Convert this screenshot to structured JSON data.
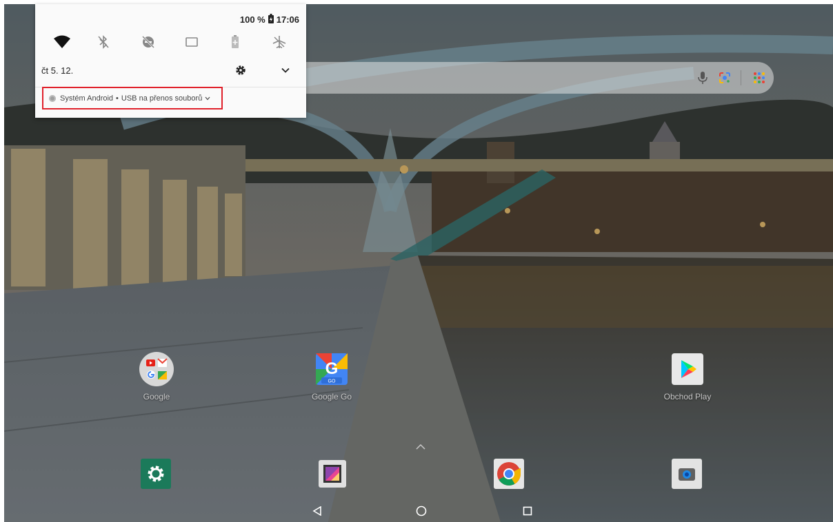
{
  "statusbar": {
    "battery": "100 %",
    "time": "17:06"
  },
  "quick_settings": [
    {
      "name": "wifi-icon",
      "state": "on"
    },
    {
      "name": "bluetooth-off-icon",
      "state": "off"
    },
    {
      "name": "do-not-disturb-off-icon",
      "state": "off"
    },
    {
      "name": "screen-cast-icon",
      "state": "off"
    },
    {
      "name": "battery-saver-icon",
      "state": "off"
    },
    {
      "name": "airplane-mode-off-icon",
      "state": "off"
    }
  ],
  "shade": {
    "date": "čt 5. 12."
  },
  "notification": {
    "app": "Systém Android",
    "separator": "•",
    "title": "USB na přenos souborů"
  },
  "home": {
    "apps": [
      {
        "label": "Google"
      },
      {
        "label": "Google Go"
      },
      {
        "label": "Obchod Play"
      }
    ],
    "dock": [
      {
        "name": "settings-app-icon"
      },
      {
        "name": "gallery-app-icon"
      },
      {
        "name": "chrome-app-icon"
      },
      {
        "name": "camera-app-icon"
      }
    ]
  },
  "colors": {
    "highlight": "#e0202a",
    "shade_bg": "#fafafa",
    "settings_green": "#1b7a5a"
  }
}
